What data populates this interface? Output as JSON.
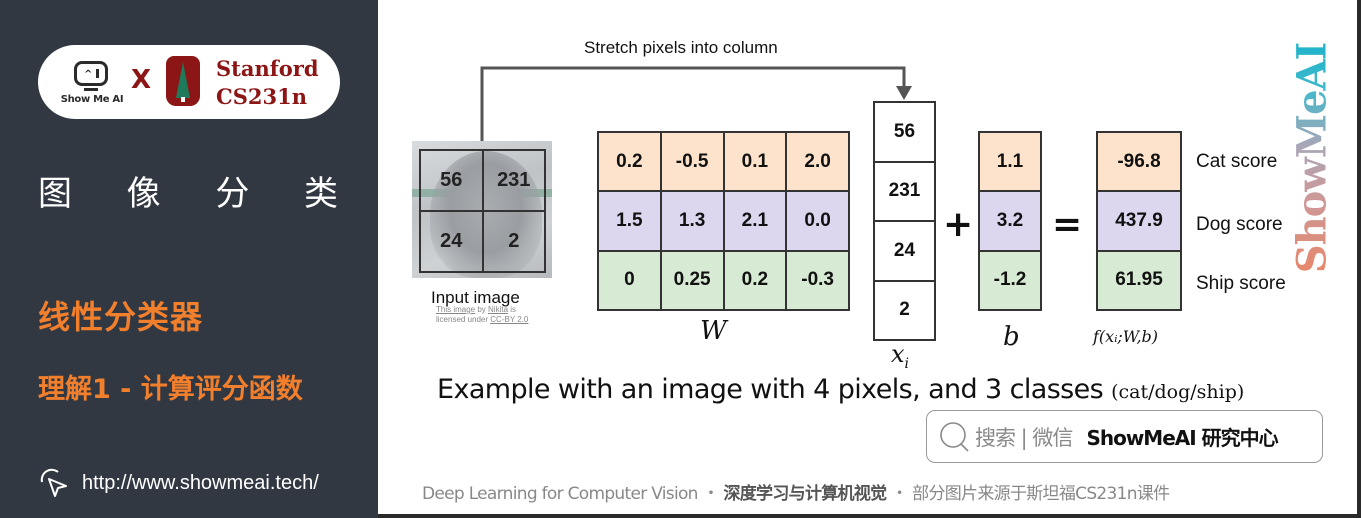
{
  "sidebar": {
    "logo": {
      "showmeai_text": "Show Me AI",
      "x_mark": "X",
      "stanford_line1": "Stanford",
      "stanford_line2": "CS231n"
    },
    "title_chars": [
      "图",
      "像",
      "分",
      "类"
    ],
    "subtitle1": "线性分类器",
    "subtitle2": "理解1 - 计算评分函数",
    "link": "http://www.showmeai.tech/",
    "colors": {
      "background": "#323842",
      "accent": "#f27f2c",
      "stanford": "#8c1515"
    }
  },
  "diagram": {
    "stretch_label": "Stretch pixels into column",
    "input_image": {
      "pixels": [
        "56",
        "231",
        "24",
        "2"
      ],
      "caption": "Input image",
      "credit": {
        "pre": "This image",
        "by": " by ",
        "author": "Nikita",
        "is": " is",
        "line2_pre": "licensed under ",
        "license": "CC-BY 2.0"
      }
    },
    "W": {
      "label": "W",
      "rows": [
        [
          "0.2",
          "-0.5",
          "0.1",
          "2.0"
        ],
        [
          "1.5",
          "1.3",
          "2.1",
          "0.0"
        ],
        [
          "0",
          "0.25",
          "0.2",
          "-0.3"
        ]
      ]
    },
    "x": {
      "label": "x",
      "subscript": "i",
      "values": [
        "56",
        "231",
        "24",
        "2"
      ]
    },
    "plus": "+",
    "b": {
      "label": "b",
      "values": [
        "1.1",
        "3.2",
        "-1.2"
      ]
    },
    "equals": "=",
    "f": {
      "label": "f(xᵢ;W,b)",
      "values": [
        "-96.8",
        "437.9",
        "61.95"
      ]
    },
    "score_labels": [
      "Cat score",
      "Dog score",
      "Ship score"
    ],
    "row_colors": [
      "#fde3cb",
      "#dcd6ee",
      "#d7ead3"
    ],
    "watermark": "ShowMeAI"
  },
  "example_caption": {
    "main": "Example with an image with 4 pixels, and 3 classes ",
    "small": "(cat/dog/ship)"
  },
  "search_box": {
    "hint": "搜索 | 微信",
    "brand": "ShowMeAI 研究中心"
  },
  "footer": {
    "part1": "Deep Learning for Computer Vision ・ ",
    "part2": "深度学习与计算机视觉",
    "part3": " ・ 部分图片来源于斯坦福CS231n课件"
  }
}
